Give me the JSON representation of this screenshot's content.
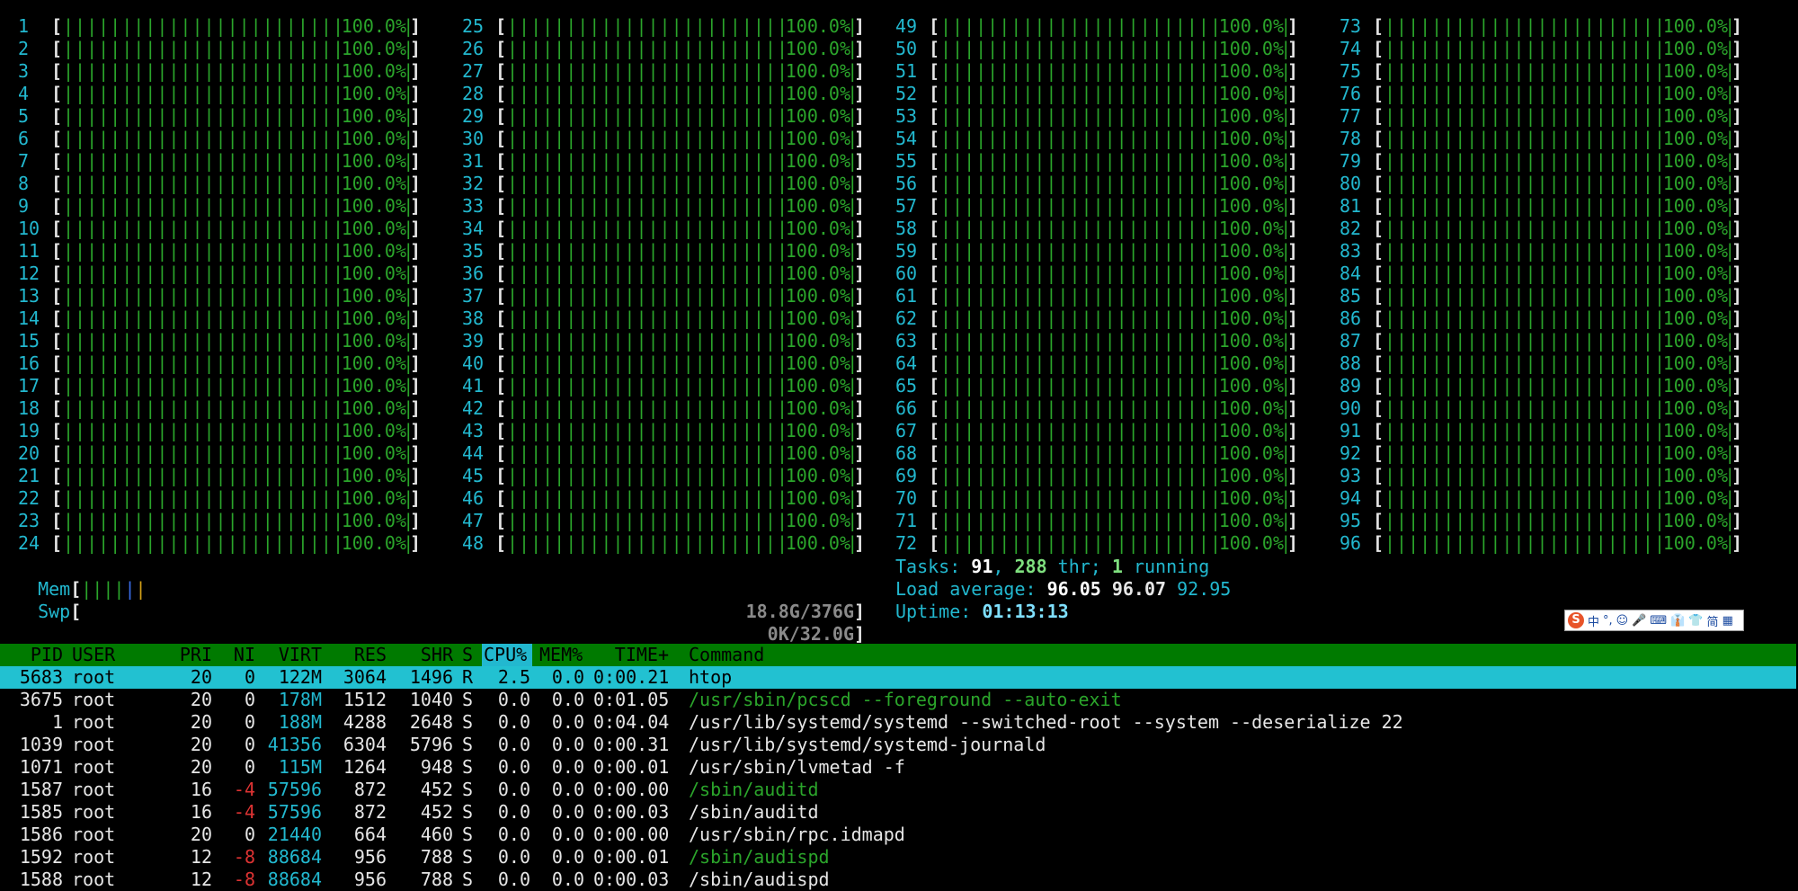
{
  "colors": {
    "accent_cyan": "#22b8cf",
    "bar_green": "#2ba52b",
    "header_green": "#007a00",
    "selected_row": "#22c1d1"
  },
  "cpus": {
    "col1": [
      {
        "num": "1",
        "pct": "100.0%"
      },
      {
        "num": "2",
        "pct": "100.0%"
      },
      {
        "num": "3",
        "pct": "100.0%"
      },
      {
        "num": "4",
        "pct": "100.0%"
      },
      {
        "num": "5",
        "pct": "100.0%"
      },
      {
        "num": "6",
        "pct": "100.0%"
      },
      {
        "num": "7",
        "pct": "100.0%"
      },
      {
        "num": "8",
        "pct": "100.0%"
      },
      {
        "num": "9",
        "pct": "100.0%"
      },
      {
        "num": "10",
        "pct": "100.0%"
      },
      {
        "num": "11",
        "pct": "100.0%"
      },
      {
        "num": "12",
        "pct": "100.0%"
      },
      {
        "num": "13",
        "pct": "100.0%"
      },
      {
        "num": "14",
        "pct": "100.0%"
      },
      {
        "num": "15",
        "pct": "100.0%"
      },
      {
        "num": "16",
        "pct": "100.0%"
      },
      {
        "num": "17",
        "pct": "100.0%"
      },
      {
        "num": "18",
        "pct": "100.0%"
      },
      {
        "num": "19",
        "pct": "100.0%"
      },
      {
        "num": "20",
        "pct": "100.0%"
      },
      {
        "num": "21",
        "pct": "100.0%"
      },
      {
        "num": "22",
        "pct": "100.0%"
      },
      {
        "num": "23",
        "pct": "100.0%"
      },
      {
        "num": "24",
        "pct": "100.0%"
      }
    ],
    "col2": [
      {
        "num": "25",
        "pct": "100.0%"
      },
      {
        "num": "26",
        "pct": "100.0%"
      },
      {
        "num": "27",
        "pct": "100.0%"
      },
      {
        "num": "28",
        "pct": "100.0%"
      },
      {
        "num": "29",
        "pct": "100.0%"
      },
      {
        "num": "30",
        "pct": "100.0%"
      },
      {
        "num": "31",
        "pct": "100.0%"
      },
      {
        "num": "32",
        "pct": "100.0%"
      },
      {
        "num": "33",
        "pct": "100.0%"
      },
      {
        "num": "34",
        "pct": "100.0%"
      },
      {
        "num": "35",
        "pct": "100.0%"
      },
      {
        "num": "36",
        "pct": "100.0%"
      },
      {
        "num": "37",
        "pct": "100.0%"
      },
      {
        "num": "38",
        "pct": "100.0%"
      },
      {
        "num": "39",
        "pct": "100.0%"
      },
      {
        "num": "40",
        "pct": "100.0%"
      },
      {
        "num": "41",
        "pct": "100.0%"
      },
      {
        "num": "42",
        "pct": "100.0%"
      },
      {
        "num": "43",
        "pct": "100.0%"
      },
      {
        "num": "44",
        "pct": "100.0%"
      },
      {
        "num": "45",
        "pct": "100.0%"
      },
      {
        "num": "46",
        "pct": "100.0%"
      },
      {
        "num": "47",
        "pct": "100.0%"
      },
      {
        "num": "48",
        "pct": "100.0%"
      }
    ],
    "col3": [
      {
        "num": "49",
        "pct": "100.0%"
      },
      {
        "num": "50",
        "pct": "100.0%"
      },
      {
        "num": "51",
        "pct": "100.0%"
      },
      {
        "num": "52",
        "pct": "100.0%"
      },
      {
        "num": "53",
        "pct": "100.0%"
      },
      {
        "num": "54",
        "pct": "100.0%"
      },
      {
        "num": "55",
        "pct": "100.0%"
      },
      {
        "num": "56",
        "pct": "100.0%"
      },
      {
        "num": "57",
        "pct": "100.0%"
      },
      {
        "num": "58",
        "pct": "100.0%"
      },
      {
        "num": "59",
        "pct": "100.0%"
      },
      {
        "num": "60",
        "pct": "100.0%"
      },
      {
        "num": "61",
        "pct": "100.0%"
      },
      {
        "num": "62",
        "pct": "100.0%"
      },
      {
        "num": "63",
        "pct": "100.0%"
      },
      {
        "num": "64",
        "pct": "100.0%"
      },
      {
        "num": "65",
        "pct": "100.0%"
      },
      {
        "num": "66",
        "pct": "100.0%"
      },
      {
        "num": "67",
        "pct": "100.0%"
      },
      {
        "num": "68",
        "pct": "100.0%"
      },
      {
        "num": "69",
        "pct": "100.0%"
      },
      {
        "num": "70",
        "pct": "100.0%"
      },
      {
        "num": "71",
        "pct": "100.0%"
      },
      {
        "num": "72",
        "pct": "100.0%"
      }
    ],
    "col4": [
      {
        "num": "73",
        "pct": "100.0%"
      },
      {
        "num": "74",
        "pct": "100.0%"
      },
      {
        "num": "75",
        "pct": "100.0%"
      },
      {
        "num": "76",
        "pct": "100.0%"
      },
      {
        "num": "77",
        "pct": "100.0%"
      },
      {
        "num": "78",
        "pct": "100.0%"
      },
      {
        "num": "79",
        "pct": "100.0%"
      },
      {
        "num": "80",
        "pct": "100.0%"
      },
      {
        "num": "81",
        "pct": "100.0%"
      },
      {
        "num": "82",
        "pct": "100.0%"
      },
      {
        "num": "83",
        "pct": "100.0%"
      },
      {
        "num": "84",
        "pct": "100.0%"
      },
      {
        "num": "85",
        "pct": "100.0%"
      },
      {
        "num": "86",
        "pct": "100.0%"
      },
      {
        "num": "87",
        "pct": "100.0%"
      },
      {
        "num": "88",
        "pct": "100.0%"
      },
      {
        "num": "89",
        "pct": "100.0%"
      },
      {
        "num": "90",
        "pct": "100.0%"
      },
      {
        "num": "91",
        "pct": "100.0%"
      },
      {
        "num": "92",
        "pct": "100.0%"
      },
      {
        "num": "93",
        "pct": "100.0%"
      },
      {
        "num": "94",
        "pct": "100.0%"
      },
      {
        "num": "95",
        "pct": "100.0%"
      },
      {
        "num": "96",
        "pct": "100.0%"
      }
    ]
  },
  "mem": {
    "label": "Mem",
    "value": "18.8G/376G"
  },
  "swp": {
    "label": "Swp",
    "value": "0K/32.0G"
  },
  "tasks": {
    "label": "Tasks: ",
    "count": "91",
    "sep": ", ",
    "threads": "288",
    "thr_label": " thr; ",
    "running": "1",
    "running_label": " running"
  },
  "load": {
    "label": "Load average: ",
    "l1": "96.05",
    "l5": "96.07",
    "l15": "92.95"
  },
  "uptime": {
    "label": "Uptime: ",
    "value": "01:13:13"
  },
  "ime_toolbar": {
    "logo": "S",
    "lang": "中",
    "punct": "°,",
    "emoji": "☺",
    "mic": "🎤",
    "keyboard": "⌨",
    "skin": "👔",
    "shirt": "👕",
    "simp": "简",
    "grid": "▦"
  },
  "process_table": {
    "headers": {
      "pid": "PID",
      "user": "USER",
      "pri": "PRI",
      "ni": "NI",
      "virt": "VIRT",
      "res": "RES",
      "shr": "SHR",
      "s": "S",
      "cpu": "CPU%",
      "mem": "MEM%",
      "time": "TIME+",
      "command": "Command"
    },
    "rows": [
      {
        "pid": "5683",
        "user": "root",
        "pri": "20",
        "ni": "0",
        "virt": "122M",
        "res": "3064",
        "shr": "1496",
        "s": "R",
        "cpu": "2.5",
        "mem": "0.0",
        "time": "0:00.21",
        "command": "htop"
      },
      {
        "pid": "3675",
        "user": "root",
        "pri": "20",
        "ni": "0",
        "virt": "178M",
        "res": "1512",
        "shr": "1040",
        "s": "S",
        "cpu": "0.0",
        "mem": "0.0",
        "time": "0:01.05",
        "command": "/usr/sbin/pcscd --foreground --auto-exit"
      },
      {
        "pid": "1",
        "user": "root",
        "pri": "20",
        "ni": "0",
        "virt": "188M",
        "res": "4288",
        "shr": "2648",
        "s": "S",
        "cpu": "0.0",
        "mem": "0.0",
        "time": "0:04.04",
        "command": "/usr/lib/systemd/systemd --switched-root --system --deserialize 22"
      },
      {
        "pid": "1039",
        "user": "root",
        "pri": "20",
        "ni": "0",
        "virt": "41356",
        "res": "6304",
        "shr": "5796",
        "s": "S",
        "cpu": "0.0",
        "mem": "0.0",
        "time": "0:00.31",
        "command": "/usr/lib/systemd/systemd-journald"
      },
      {
        "pid": "1071",
        "user": "root",
        "pri": "20",
        "ni": "0",
        "virt": "115M",
        "res": "1264",
        "shr": "948",
        "s": "S",
        "cpu": "0.0",
        "mem": "0.0",
        "time": "0:00.01",
        "command": "/usr/sbin/lvmetad -f"
      },
      {
        "pid": "1587",
        "user": "root",
        "pri": "16",
        "ni": "-4",
        "virt": "57596",
        "res": "872",
        "shr": "452",
        "s": "S",
        "cpu": "0.0",
        "mem": "0.0",
        "time": "0:00.00",
        "command": "/sbin/auditd"
      },
      {
        "pid": "1585",
        "user": "root",
        "pri": "16",
        "ni": "-4",
        "virt": "57596",
        "res": "872",
        "shr": "452",
        "s": "S",
        "cpu": "0.0",
        "mem": "0.0",
        "time": "0:00.03",
        "command": "/sbin/auditd"
      },
      {
        "pid": "1586",
        "user": "root",
        "pri": "20",
        "ni": "0",
        "virt": "21440",
        "res": "664",
        "shr": "460",
        "s": "S",
        "cpu": "0.0",
        "mem": "0.0",
        "time": "0:00.00",
        "command": "/usr/sbin/rpc.idmapd"
      },
      {
        "pid": "1592",
        "user": "root",
        "pri": "12",
        "ni": "-8",
        "virt": "88684",
        "res": "956",
        "shr": "788",
        "s": "S",
        "cpu": "0.0",
        "mem": "0.0",
        "time": "0:00.01",
        "command": "/sbin/audispd"
      },
      {
        "pid": "1588",
        "user": "root",
        "pri": "12",
        "ni": "-8",
        "virt": "88684",
        "res": "956",
        "shr": "788",
        "s": "S",
        "cpu": "0.0",
        "mem": "0.0",
        "time": "0:00.03",
        "command": "/sbin/audispd"
      }
    ]
  }
}
